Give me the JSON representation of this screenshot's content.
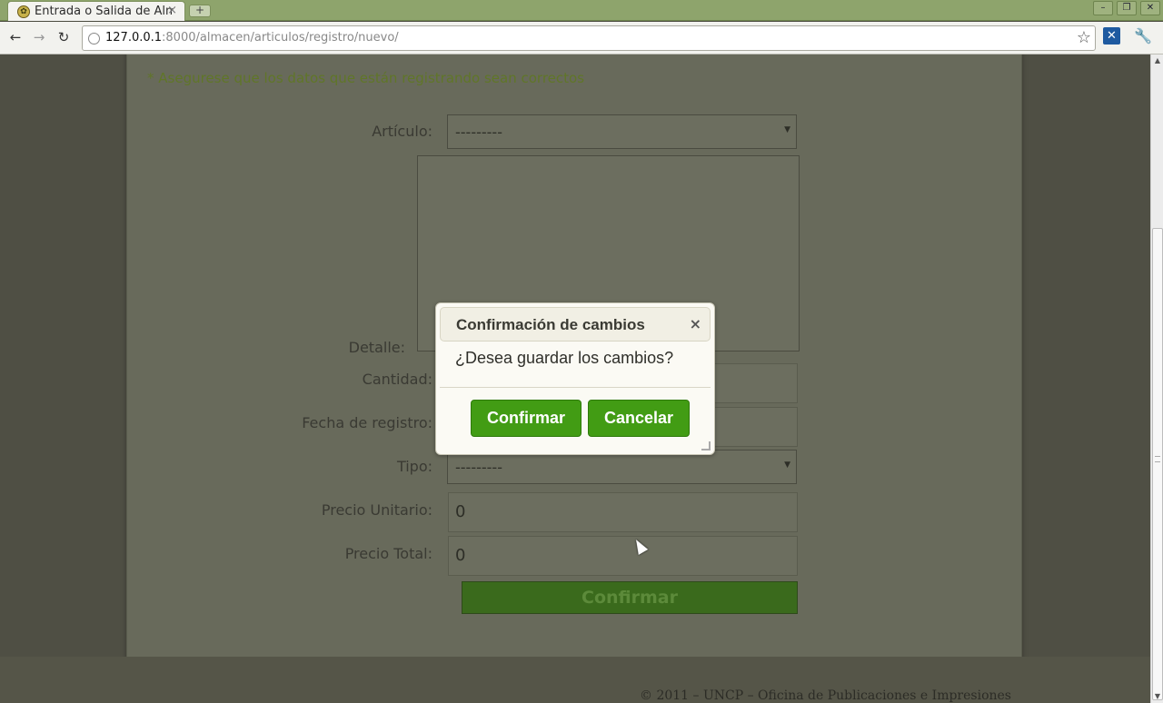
{
  "browser": {
    "tab_title": "Entrada o Salida de Alm",
    "tab_close": "×",
    "new_tab": "+",
    "url_host": "127.0.0.1",
    "url_rest": ":8000/almacen/articulos/registro/nuevo/",
    "back": "←",
    "forward": "→",
    "reload": "↻",
    "star": "☆",
    "wrench": "🔧",
    "ext": "✕",
    "win_min": "–",
    "win_max": "❐",
    "win_close": "✕"
  },
  "form": {
    "warning": "* Asegurese que los datos que están registrando sean correctos",
    "articulo_label": "Artículo:",
    "articulo_value": "---------",
    "detalle_label": "Detalle:",
    "cantidad_label": "Cantidad:",
    "fecha_label": "Fecha de registro:",
    "tipo_label": "Tipo:",
    "tipo_value": "---------",
    "precio_unitario_label": "Precio Unitario:",
    "precio_unitario_value": "0",
    "precio_total_label": "Precio Total:",
    "precio_total_value": "0",
    "submit_label": "Confirmar"
  },
  "footer": "© 2011 – UNCP – Oficina de Publicaciones e Impresiones",
  "dialog": {
    "title": "Confirmación de cambios",
    "close": "×",
    "message": "¿Desea guardar los cambios?",
    "confirm_label": "Confirmar",
    "cancel_label": "Cancelar"
  },
  "scrollbar": {
    "up": "▲",
    "down": "▼"
  },
  "colors": {
    "accent_green": "#429c14",
    "warning_green": "#607628"
  }
}
